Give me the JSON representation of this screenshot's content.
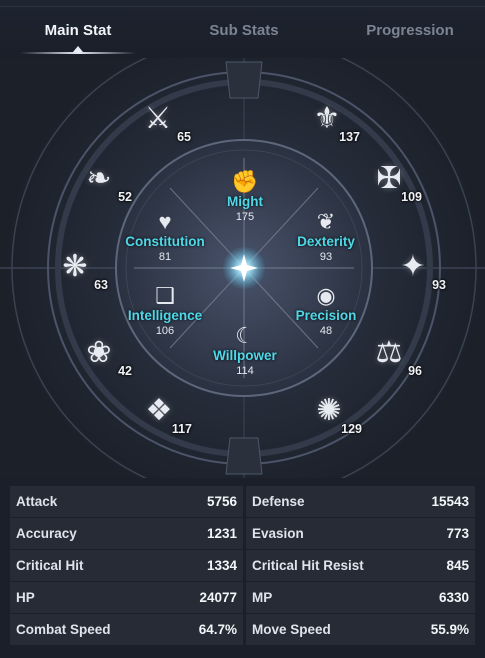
{
  "tabs": [
    {
      "label": "Main Stat",
      "active": true
    },
    {
      "label": "Sub Stats",
      "active": false
    },
    {
      "label": "Progression",
      "active": false
    }
  ],
  "inner_stats": {
    "might": {
      "name": "Might",
      "value": "175",
      "icon": "fist-icon"
    },
    "constitution": {
      "name": "Constitution",
      "value": "81",
      "icon": "heart-icon"
    },
    "dexterity": {
      "name": "Dexterity",
      "value": "93",
      "icon": "feather-icon"
    },
    "intelligence": {
      "name": "Intelligence",
      "value": "106",
      "icon": "book-icon"
    },
    "precision": {
      "name": "Precision",
      "value": "48",
      "icon": "eye-icon"
    },
    "willpower": {
      "name": "Willpower",
      "value": "114",
      "icon": "crescent-icon"
    }
  },
  "outer_nodes": [
    {
      "value": "65",
      "icon": "sword-emblem-icon"
    },
    {
      "value": "137",
      "icon": "winged-sword-icon"
    },
    {
      "value": "52",
      "icon": "phoenix-icon"
    },
    {
      "value": "109",
      "icon": "crossed-blades-icon"
    },
    {
      "value": "63",
      "icon": "moth-icon"
    },
    {
      "value": "93",
      "icon": "star-icon"
    },
    {
      "value": "42",
      "icon": "tree-icon"
    },
    {
      "value": "96",
      "icon": "scales-icon"
    },
    {
      "value": "117",
      "icon": "crystal-icon"
    },
    {
      "value": "129",
      "icon": "vortex-icon"
    }
  ],
  "stats": [
    {
      "left_label": "Attack",
      "left_value": "5756",
      "right_label": "Defense",
      "right_value": "15543"
    },
    {
      "left_label": "Accuracy",
      "left_value": "1231",
      "right_label": "Evasion",
      "right_value": "773"
    },
    {
      "left_label": "Critical Hit",
      "left_value": "1334",
      "right_label": "Critical Hit Resist",
      "right_value": "845"
    },
    {
      "left_label": "HP",
      "left_value": "24077",
      "right_label": "MP",
      "right_value": "6330"
    },
    {
      "left_label": "Combat Speed",
      "left_value": "64.7%",
      "right_label": "Move Speed",
      "right_value": "55.9%"
    }
  ],
  "colors": {
    "accent_cyan": "#4fd8e8",
    "panel_bg": "#262b36",
    "page_bg": "#1a1f2a"
  }
}
